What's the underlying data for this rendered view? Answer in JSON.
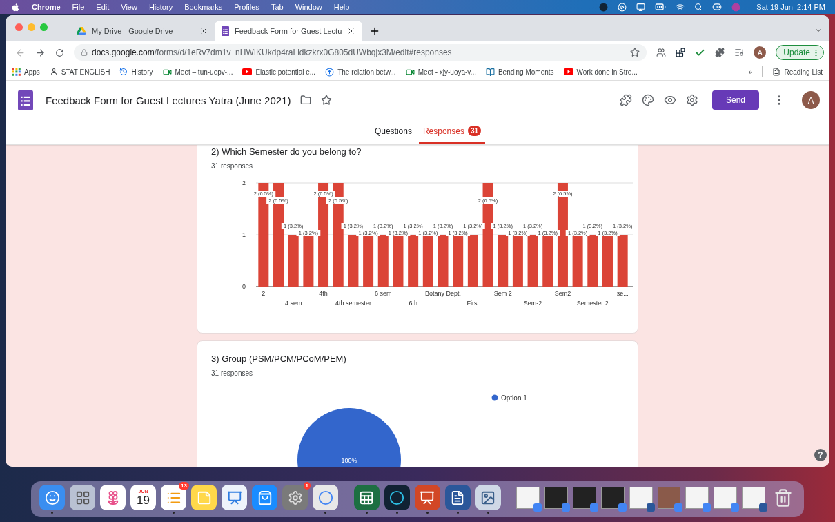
{
  "menu_bar": {
    "app": "Chrome",
    "menus": [
      "File",
      "Edit",
      "View",
      "History",
      "Bookmarks",
      "Profiles",
      "Tab",
      "Window",
      "Help"
    ],
    "clock": "Sat 19 Jun  2:14 PM"
  },
  "browser": {
    "tabs": [
      {
        "title": "My Drive - Google Drive",
        "kind": "drive",
        "selected": false
      },
      {
        "title": "Feedback Form for Guest Lectu",
        "kind": "forms",
        "selected": true
      }
    ],
    "url_host": "docs.google.com",
    "url_path": "/forms/d/1eRv7dm1v_nHWIKUkdp4raLldkzkrx0G805dUWbqjx3M/edit#responses",
    "profile_initial": "A",
    "update_label": "Update",
    "bookmarks": [
      {
        "label": "Apps",
        "kind": "apps"
      },
      {
        "label": "STAT ENGLISH",
        "kind": "person"
      },
      {
        "label": "History",
        "kind": "history"
      },
      {
        "label": "Meet – tun-uepv-...",
        "kind": "meet"
      },
      {
        "label": "Elastic potential e...",
        "kind": "youtube"
      },
      {
        "label": "The relation betw...",
        "kind": "upload"
      },
      {
        "label": "Meet - xjy-uoya-v...",
        "kind": "meet"
      },
      {
        "label": "Bending Moments",
        "kind": "book"
      },
      {
        "label": "Work done in Stre...",
        "kind": "youtube"
      }
    ],
    "more_bookmarks": "»",
    "reading_list": "Reading List"
  },
  "form": {
    "title": "Feedback Form for Guest Lectures Yatra (June 2021)",
    "send": "Send",
    "avatar": "A",
    "tabs": [
      {
        "label": "Questions",
        "selected": false
      },
      {
        "label": "Responses",
        "selected": true,
        "count": "31"
      }
    ]
  },
  "questions": [
    {
      "title": "2) Which Semester do you belong to?",
      "responses": "31 responses",
      "chart_data": {
        "type": "bar",
        "categories": [
          "2",
          null,
          "4 sem",
          null,
          "4th",
          null,
          "4th semester",
          null,
          "6 sem",
          null,
          "6th",
          null,
          "Botany Dept.",
          null,
          "First",
          null,
          "Sem 2",
          null,
          "Sem-2",
          null,
          "Sem2",
          null,
          "Semester 2",
          null,
          "se..."
        ],
        "values": [
          2,
          2,
          1,
          1,
          2,
          2,
          1,
          1,
          1,
          1,
          1,
          1,
          1,
          1,
          1,
          2,
          1,
          1,
          1,
          1,
          2,
          1,
          1,
          1,
          1
        ],
        "ylim": [
          0,
          2
        ],
        "yticks": [
          0,
          1,
          2
        ],
        "value_labels": [
          "2 (6.5%)",
          "2 (6.5%)",
          "1 (3.2%)",
          "1 (3.2%)",
          "2 (6.5%)",
          "2 (6.5%)",
          "1 (3.2%)",
          "1 (3.2%)",
          "1 (3.2%)",
          "1 (3.2%)",
          "1 (3.2%)",
          "1 (3.2%)",
          "1 (3.2%)",
          "1 (3.2%)",
          "1 (3.2%)",
          "2 (6.5%)",
          "1 (3.2%)",
          "1 (3.2%)",
          "1 (3.2%)",
          "1 (3.2%)",
          "2 (6.5%)",
          "1 (3.2%)",
          "1 (3.2%)",
          "1 (3.2%)",
          "1 (3.2%)"
        ]
      }
    },
    {
      "title": "3) Group (PSM/PCM/PCoM/PEM)",
      "responses": "31 responses",
      "chart_data": {
        "type": "pie",
        "categories": [
          "Option 1"
        ],
        "values": [
          100
        ],
        "value_labels": [
          "100%"
        ]
      }
    }
  ],
  "help": "?",
  "dock": {
    "apps": [
      {
        "kind": "finder",
        "running": true
      },
      {
        "kind": "launchpad",
        "running": false
      },
      {
        "kind": "photos",
        "running": false
      },
      {
        "kind": "calendar",
        "month": "JUN",
        "day": "19",
        "running": false
      },
      {
        "kind": "reminders",
        "badge": "13",
        "running": true
      },
      {
        "kind": "notes",
        "running": false
      },
      {
        "kind": "keynote",
        "running": false
      },
      {
        "kind": "appstore",
        "running": false
      },
      {
        "kind": "settings",
        "badge": "1",
        "running": false
      },
      {
        "kind": "chrome",
        "running": true
      }
    ],
    "documents": [
      {
        "kind": "excel",
        "running": true
      },
      {
        "kind": "webex",
        "running": true
      },
      {
        "kind": "powerpoint",
        "running": true
      },
      {
        "kind": "word",
        "running": true
      },
      {
        "kind": "preview",
        "running": true
      }
    ],
    "windows": [
      {
        "kind": "light",
        "color": "#4285f4"
      },
      {
        "kind": "dark",
        "color": "#4285f4"
      },
      {
        "kind": "dark",
        "color": "#4285f4"
      },
      {
        "kind": "dark",
        "color": "#4285f4"
      },
      {
        "kind": "light",
        "color": "#2b579a"
      },
      {
        "kind": "photo",
        "color": "#4285f4"
      },
      {
        "kind": "light",
        "color": "#4285f4"
      },
      {
        "kind": "light",
        "color": "#4285f4"
      },
      {
        "kind": "light",
        "color": "#2b579a"
      }
    ]
  }
}
